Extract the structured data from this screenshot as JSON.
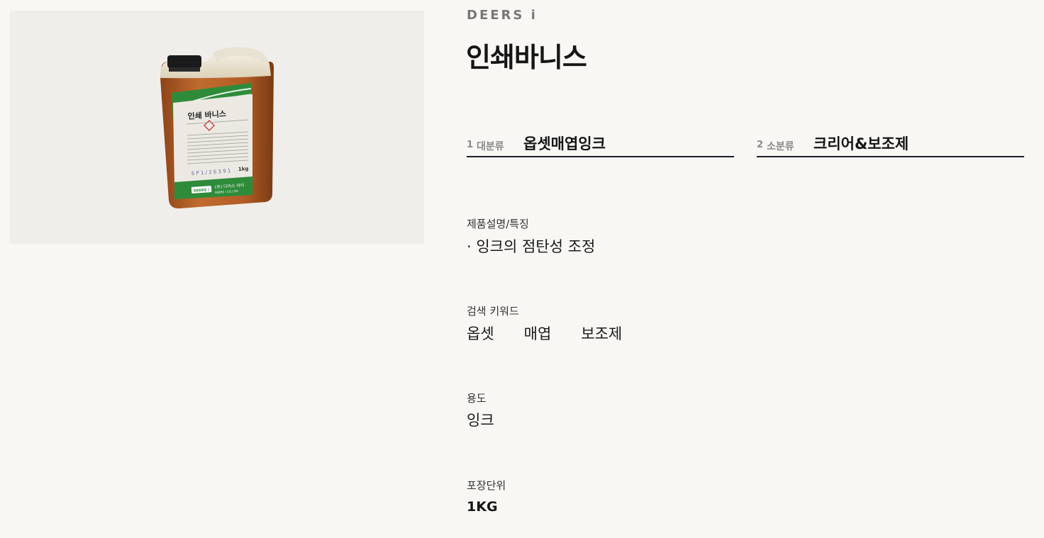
{
  "brand": "DEERS i",
  "product": {
    "title": "인쇄바니스",
    "image": {
      "label_title": "인쇄 바니스",
      "label_code": "6 P 1 / 2 6 3 9 1",
      "label_weight": "1kg",
      "label_brand": "DEERS i",
      "label_company_ko": "(주) 디어스 아이",
      "label_company_en": "DEERS i CO.,LTD."
    }
  },
  "categories": [
    {
      "num": "1",
      "label": "대분류",
      "value": "옵셋매엽잉크"
    },
    {
      "num": "2",
      "label": "소분류",
      "value": "크리어&보조제"
    }
  ],
  "details": {
    "description": {
      "label": "제품설명/특징",
      "value": "· 잉크의 점탄성 조정"
    },
    "keywords": {
      "label": "검색 키워드",
      "items": [
        "옵셋",
        "매엽",
        "보조제"
      ]
    },
    "usage": {
      "label": "용도",
      "value": "잉크"
    },
    "packaging": {
      "label": "포장단위",
      "value": "1KG"
    }
  },
  "colors": {
    "background": "#f8f7f4",
    "label_green": "#2e8b3a",
    "liquid_amber": "#b5622a",
    "cap_black": "#1a1a1a",
    "divider": "#1e1e2a"
  }
}
